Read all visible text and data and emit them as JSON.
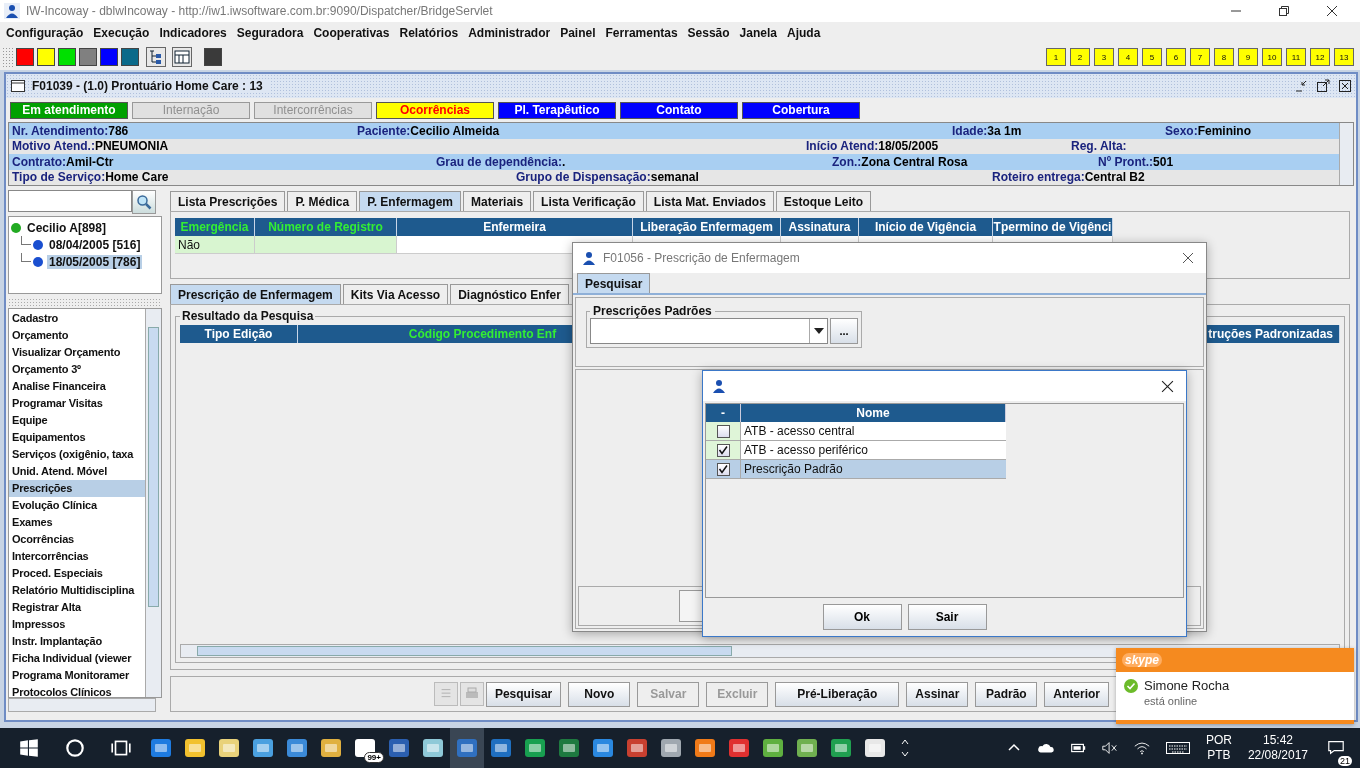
{
  "app_window": {
    "title": "IW-Incoway - dblwIncoway - http://iw1.iwsoftware.com.br:9090/Dispatcher/BridgeServlet"
  },
  "menu": [
    "Configuração",
    "Execução",
    "Indicadores",
    "Seguradora",
    "Cooperativas",
    "Relatórios",
    "Administrador",
    "Painel",
    "Ferramentas",
    "Sessão",
    "Janela",
    "Ajuda"
  ],
  "toolbar": {
    "color_buttons": [
      {
        "color": "#ff0000"
      },
      {
        "color": "#ffff00"
      },
      {
        "color": "#00e000"
      },
      {
        "color": "#808080"
      },
      {
        "color": "#0000ff"
      },
      {
        "color": "#0a6a8a"
      }
    ],
    "number_buttons": [
      "1",
      "2",
      "3",
      "4",
      "5",
      "6",
      "7",
      "8",
      "9",
      "10",
      "11",
      "12",
      "13"
    ]
  },
  "frame": {
    "title": "F01039 - (1.0) Prontuário Home Care : 13"
  },
  "status_buttons": [
    {
      "label": "Em atendimento",
      "color": "#00a000",
      "disabled": false
    },
    {
      "label": "Internação",
      "color": "#e0e0e0",
      "disabled": true
    },
    {
      "label": "Intercorrências",
      "color": "#e0e0e0",
      "disabled": true
    },
    {
      "label": "Ocorrências",
      "color": "#ffff00",
      "disabled": false
    },
    {
      "label": "Pl. Terapêutico",
      "color": "#0000ff",
      "disabled": false
    },
    {
      "label": "Contato",
      "color": "#0000ff",
      "disabled": false
    },
    {
      "label": "Cobertura",
      "color": "#0000ff",
      "disabled": false
    }
  ],
  "patient_info": [
    {
      "fields": [
        {
          "label": "Nr. Atendimento:",
          "value": "786"
        },
        {
          "label": "Paciente:",
          "value": "Cecilio Almeida"
        },
        {
          "label": "Idade:",
          "value": "3a 1m"
        },
        {
          "label": "Sexo:",
          "value": "Feminino"
        }
      ]
    },
    {
      "fields": [
        {
          "label": "Motivo Atend.:",
          "value": "PNEUMONIA"
        },
        {
          "label": "Início Atend:",
          "value": "18/05/2005"
        },
        {
          "label": "Reg. Alta:"
        }
      ]
    },
    {
      "fields": [
        {
          "label": "Contrato:",
          "value": "Amil-Ctr"
        },
        {
          "label": "Grau de dependência:",
          "value": "."
        },
        {
          "label": "Zon.:",
          "value": "Zona Central Rosa"
        },
        {
          "label": "Nº Pront.:",
          "value": "501"
        }
      ]
    },
    {
      "fields": [
        {
          "label": "Tipo de Serviço:",
          "value": "Home Care"
        },
        {
          "label": "Grupo de Dispensação:",
          "value": "semanal"
        },
        {
          "label": "Roteiro entrega:",
          "value": "Central B2"
        }
      ]
    }
  ],
  "tree": [
    {
      "label": "Cecilio A[898]",
      "color": "#22aa22",
      "selected": false,
      "children": [
        {
          "label": "08/04/2005 [516]",
          "color": "#1a4fd0",
          "selected": false
        },
        {
          "label": "18/05/2005 [786]",
          "color": "#1a4fd0",
          "selected": true
        }
      ]
    }
  ],
  "side_menu": [
    {
      "label": "Cadastro",
      "selected": false
    },
    {
      "label": "Orçamento",
      "selected": false
    },
    {
      "label": "Visualizar Orçamento",
      "selected": false
    },
    {
      "label": "Orçamento 3º",
      "selected": false
    },
    {
      "label": "Analise Financeira",
      "selected": false
    },
    {
      "label": "Programar Visitas",
      "selected": false
    },
    {
      "label": "Equipe",
      "selected": false
    },
    {
      "label": "Equipamentos",
      "selected": false
    },
    {
      "label": "Serviços (oxigênio, taxa",
      "selected": false
    },
    {
      "label": "Unid. Atend. Móvel",
      "selected": false
    },
    {
      "label": "Prescrições",
      "selected": true
    },
    {
      "label": "Evolução Clínica",
      "selected": false
    },
    {
      "label": "Exames",
      "selected": false
    },
    {
      "label": "Ocorrências",
      "selected": false
    },
    {
      "label": "Intercorrências",
      "selected": false
    },
    {
      "label": "Proced. Especiais",
      "selected": false
    },
    {
      "label": "Relatório Multidisciplina",
      "selected": false
    },
    {
      "label": "Registrar Alta",
      "selected": false
    },
    {
      "label": "Impressos",
      "selected": false
    },
    {
      "label": "Instr. Implantação",
      "selected": false
    },
    {
      "label": "Ficha Individual (viewer",
      "selected": false
    },
    {
      "label": "Programa Monitoramer",
      "selected": false
    },
    {
      "label": "Protocolos Clínicos",
      "selected": false
    }
  ],
  "tabs": [
    {
      "label": "Lista Prescrições",
      "selected": false
    },
    {
      "label": "P. Médica",
      "selected": false
    },
    {
      "label": "P. Enfermagem",
      "selected": true
    },
    {
      "label": "Materiais",
      "selected": false
    },
    {
      "label": "Lista Verificação",
      "selected": false
    },
    {
      "label": "Lista Mat. Enviados",
      "selected": false
    },
    {
      "label": "Estoque Leito",
      "selected": false
    }
  ],
  "record_table": {
    "columns": [
      {
        "label": "Emergência",
        "highlight": true
      },
      {
        "label": "Número de Registro",
        "highlight": true
      },
      {
        "label": "Enfermeira",
        "highlight": false
      },
      {
        "label": "Liberação Enfermagem",
        "highlight": false
      },
      {
        "label": "Assinatura",
        "highlight": false
      },
      {
        "label": "Início de Vigência",
        "highlight": false
      },
      {
        "label": "Tpermino de Vigênci",
        "highlight": false
      }
    ],
    "rows": [
      {
        "cells": [
          "Não"
        ]
      }
    ]
  },
  "sub_tabs": [
    {
      "label": "Prescrição de Enfermagem",
      "selected": true
    },
    {
      "label": "Kits Via Acesso",
      "selected": false
    },
    {
      "label": "Diagnóstico Enfer",
      "selected": false
    }
  ],
  "results": {
    "title": "Resultado da Pesquisa",
    "columns": [
      {
        "label": "Tipo Edição",
        "highlight": false
      },
      {
        "label": "Código Procedimento Enf",
        "highlight": true
      },
      {
        "label": "truções Padronizadas",
        "highlight": false
      }
    ]
  },
  "action_buttons": [
    {
      "label": "Pesquisar",
      "disabled": false
    },
    {
      "label": "Novo",
      "disabled": false
    },
    {
      "label": "Salvar",
      "disabled": true
    },
    {
      "label": "Excluir",
      "disabled": true
    },
    {
      "label": "Pré-Liberação",
      "disabled": false
    },
    {
      "label": "Assinar",
      "disabled": false
    },
    {
      "label": "Padrão",
      "disabled": false
    },
    {
      "label": "Anterior",
      "disabled": false
    }
  ],
  "dialog": {
    "title": "F01056 - Prescrição de Enfermagem",
    "tabs": [
      {
        "label": "Pesquisar",
        "selected": true
      }
    ],
    "group_title": "Prescrições Padrões",
    "browse_button": "..."
  },
  "chooser": {
    "columns": [
      "-",
      "Nome"
    ],
    "rows": [
      {
        "name": "ATB - acesso central",
        "checked": false,
        "selected": false
      },
      {
        "name": "ATB - acesso periférico",
        "checked": true,
        "selected": false
      },
      {
        "name": "Prescrição Padrão",
        "checked": true,
        "selected": true
      }
    ],
    "buttons": [
      "Ok",
      "Sair"
    ]
  },
  "notification": {
    "app": "skype",
    "name": "Simone Rocha",
    "status": "está online"
  },
  "taskbar": {
    "badge": "99+",
    "language": [
      "POR",
      "PTB"
    ],
    "time": "15:42",
    "date": "22/08/2017",
    "notifications": "21"
  }
}
